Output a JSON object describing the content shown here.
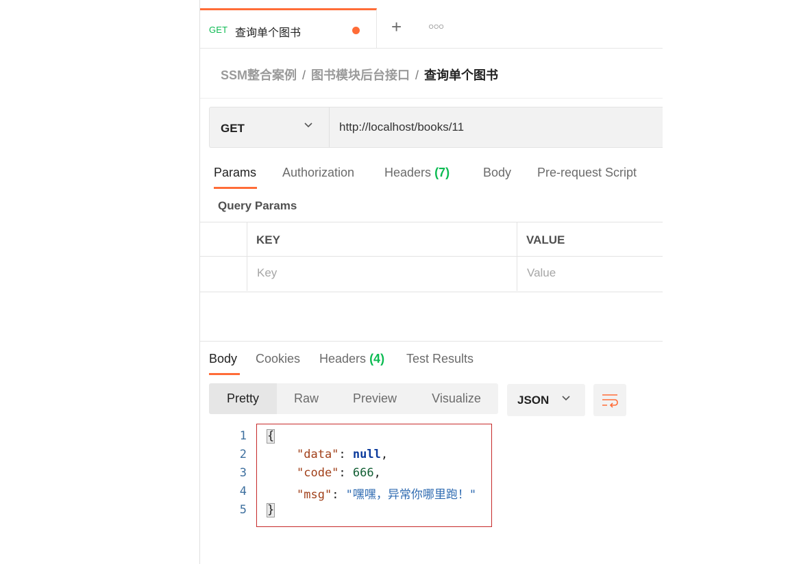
{
  "tab": {
    "method": "GET",
    "title": "查询单个图书",
    "add_icon": "plus-icon",
    "more_icon": "more-horizontal-icon"
  },
  "breadcrumb": {
    "items": [
      "SSM整合案例",
      "图书模块后台接口"
    ],
    "current": "查询单个图书",
    "separator": "/"
  },
  "request": {
    "method": "GET",
    "url": "http://localhost/books/11"
  },
  "request_tabs": [
    {
      "label": "Params"
    },
    {
      "label": "Authorization"
    },
    {
      "label": "Headers",
      "count": "(7)"
    },
    {
      "label": "Body"
    },
    {
      "label": "Pre-request Script"
    }
  ],
  "query_params": {
    "title": "Query Params",
    "columns": [
      "KEY",
      "VALUE"
    ],
    "placeholders": {
      "key": "Key",
      "value": "Value"
    }
  },
  "response_tabs": [
    {
      "label": "Body"
    },
    {
      "label": "Cookies"
    },
    {
      "label": "Headers",
      "count": "(4)"
    },
    {
      "label": "Test Results"
    }
  ],
  "format_buttons": [
    "Pretty",
    "Raw",
    "Preview",
    "Visualize"
  ],
  "language": "JSON",
  "response_body": {
    "line_numbers": [
      "1",
      "2",
      "3",
      "4",
      "5"
    ],
    "open_brace": "{",
    "close_brace": "}",
    "fields": [
      {
        "key": "\"data\"",
        "value": "null"
      },
      {
        "key": "\"code\"",
        "value": "666"
      },
      {
        "key": "\"msg\"",
        "value": "\"嘿嘿，异常你哪里跑！\""
      }
    ]
  },
  "colors": {
    "accent": "#ff6c37",
    "get_method": "#0cbb52",
    "highlight_box": "#c62828"
  }
}
